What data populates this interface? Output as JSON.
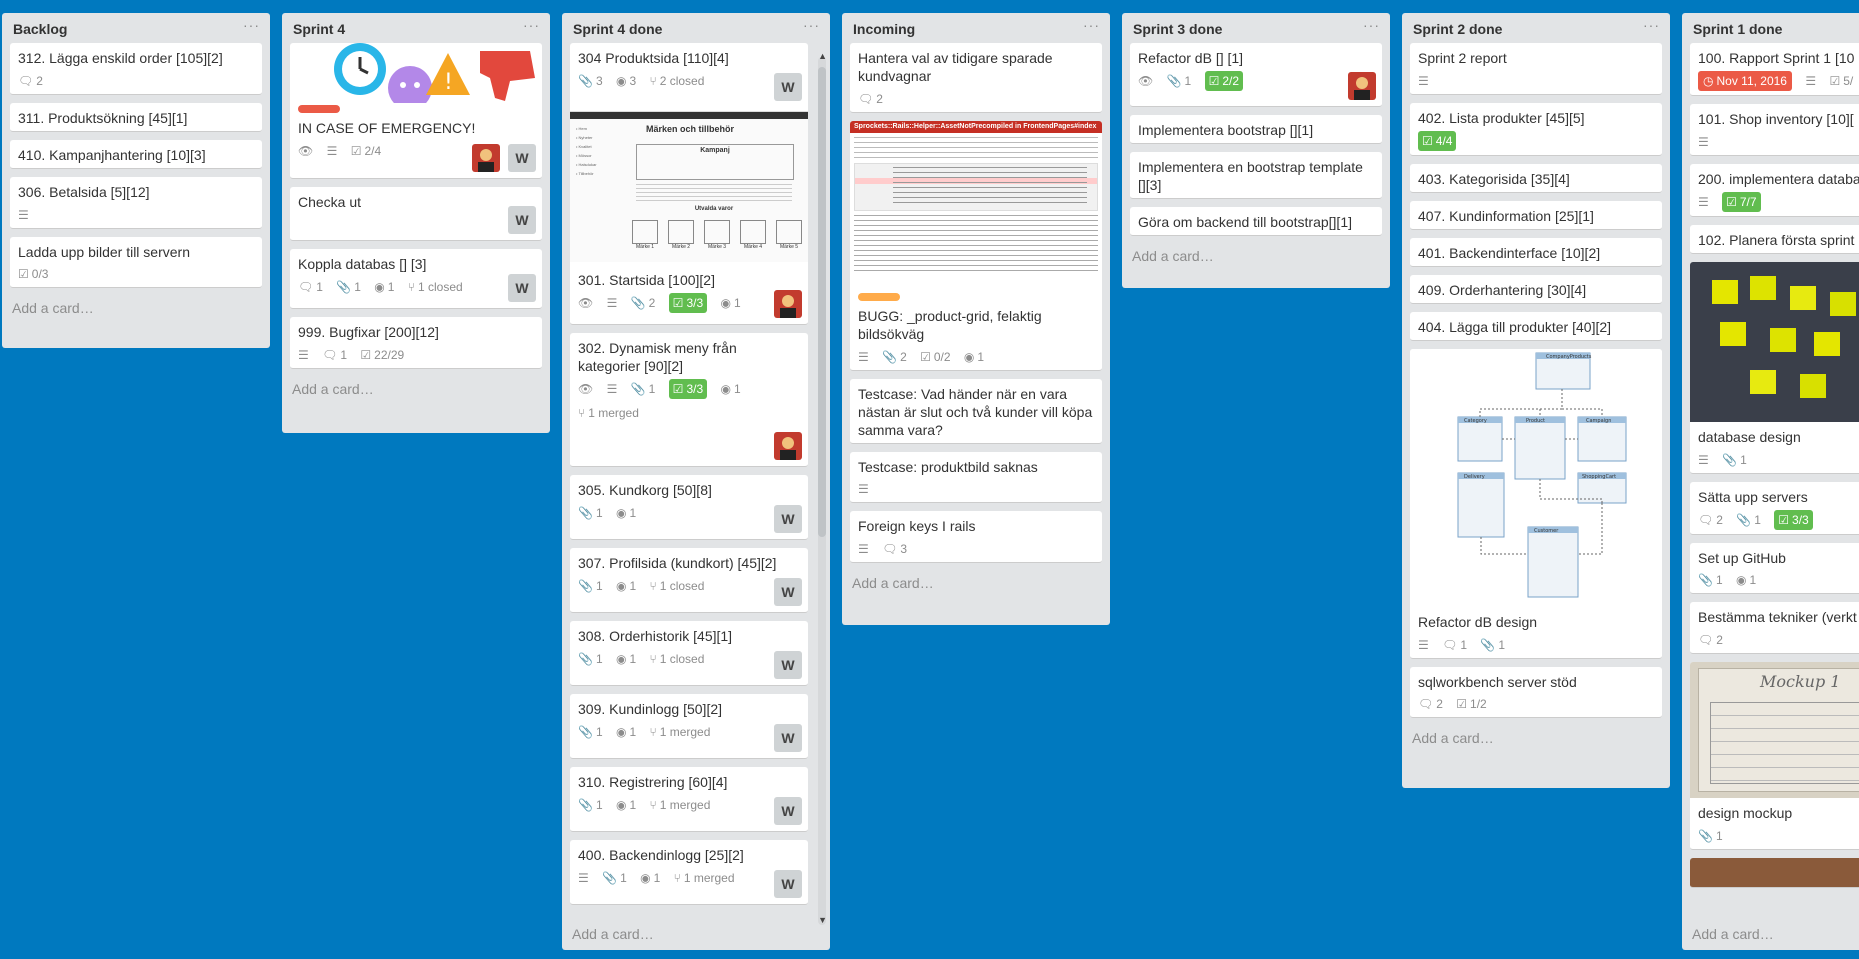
{
  "board": {
    "add_card_label": "Add a card…",
    "colors": {
      "background": "#0079bf",
      "list": "#e2e4e6",
      "green": "#61bd4f",
      "red": "#eb5a46",
      "orange": "#ffab4a"
    },
    "lists": [
      {
        "title": "Backlog",
        "cards": [
          {
            "title": "312. Lägga enskild order [105][2]",
            "comments": "2"
          },
          {
            "title": "311. Produktsökning [45][1]"
          },
          {
            "title": "410. Kampanjhantering [10][3]"
          },
          {
            "title": "306. Betalsida [5][12]",
            "description": true
          },
          {
            "title": "Ladda upp bilder till servern",
            "checklist": "0/3"
          }
        ]
      },
      {
        "title": "Sprint 4",
        "cards": [
          {
            "title": "IN CASE OF EMERGENCY!",
            "label_color": "#eb5a46",
            "checklist": "2/4",
            "member": "W"
          },
          {
            "title": "Checka ut",
            "member": "W"
          },
          {
            "title": "Koppla databas [] [3]",
            "comments": "1",
            "attachments": "1",
            "github": "1",
            "pr": "1 closed",
            "member": "W"
          },
          {
            "title": "999. Bugfixar [200][12]",
            "comments": "1",
            "checklist": "22/29"
          }
        ]
      },
      {
        "title": "Sprint 4 done",
        "cards": [
          {
            "title": "304 Produktsida [110][4]",
            "attachments": "3",
            "github": "3",
            "pr": "2 closed",
            "member": "W"
          },
          {
            "title": "301. Startsida [100][2]",
            "attachments": "2",
            "checklist": "3/3",
            "github": "1"
          },
          {
            "title": "302. Dynamisk meny från kategorier [90][2]",
            "attachments": "1",
            "checklist": "3/3",
            "github": "1",
            "pr": "1 merged"
          },
          {
            "title": "305. Kundkorg [50][8]",
            "attachments": "1",
            "github": "1",
            "member": "W"
          },
          {
            "title": "307. Profilsida (kundkort) [45][2]",
            "attachments": "1",
            "github": "1",
            "pr": "1 closed",
            "member": "W"
          },
          {
            "title": "308. Orderhistorik [45][1]",
            "attachments": "1",
            "github": "1",
            "pr": "1 closed",
            "member": "W"
          },
          {
            "title": "309. Kundinlogg [50][2]",
            "attachments": "1",
            "github": "1",
            "pr": "1 merged",
            "member": "W"
          },
          {
            "title": "310. Registrering [60][4]",
            "attachments": "1",
            "github": "1",
            "pr": "1 merged",
            "member": "W"
          },
          {
            "title": "400. Backendinlogg [25][2]",
            "attachments": "1",
            "github": "1",
            "pr": "1 merged",
            "member": "W"
          }
        ],
        "mockup": {
          "title": "Märken och tillbehör",
          "banner": "Kampanj",
          "section": "Utvalda varor",
          "items": [
            "Märke 1",
            "Märke 2",
            "Märke 3",
            "Märke 4",
            "Märke 5"
          ]
        }
      },
      {
        "title": "Incoming",
        "cards": [
          {
            "title": "Hantera val av tidigare sparade kundvagnar",
            "comments": "2"
          },
          {
            "title": "BUGG: _product-grid, felaktig bildsökväg",
            "label_color": "#ffab4a",
            "attachments": "2",
            "checklist": "0/2",
            "github": "1"
          },
          {
            "title": "Testcase: Vad händer när en vara nästan är slut och två kunder vill köpa samma vara?"
          },
          {
            "title": "Testcase: produktbild saknas"
          },
          {
            "title": "Foreign keys I rails",
            "comments": "3"
          }
        ],
        "error_image": {
          "heading": "Sprockets::Rails::Helper::AssetNotPrecompiled in FrontendPages#index"
        }
      },
      {
        "title": "Sprint 3 done",
        "cards": [
          {
            "title": "Refactor dB [] [1]",
            "attachments": "1",
            "checklist": "2/2"
          },
          {
            "title": "Implementera bootstrap [][1]"
          },
          {
            "title": "Implementera en bootstrap template [][3]"
          },
          {
            "title": "Göra om backend till bootstrap[][1]"
          }
        ]
      },
      {
        "title": "Sprint 2 done",
        "cards": [
          {
            "title": "Sprint 2 report"
          },
          {
            "title": "402. Lista produkter [45][5]",
            "checklist": "4/4"
          },
          {
            "title": "403. Kategorisida [35][4]"
          },
          {
            "title": "407. Kundinformation [25][1]"
          },
          {
            "title": "401. Backendinterface [10][2]"
          },
          {
            "title": "409. Orderhantering [30][4]"
          },
          {
            "title": "404. Lägga till produkter [40][2]"
          },
          {
            "title": "Refactor dB design",
            "comments": "1",
            "attachments": "1"
          },
          {
            "title": "sqlworkbench server stöd",
            "comments": "2",
            "checklist": "1/2"
          }
        ],
        "erd_tables": [
          "CompanyProducts",
          "Category",
          "Product",
          "Campaign",
          "Delivery",
          "ShoppingCart",
          "Customer"
        ]
      },
      {
        "title": "Sprint 1 done",
        "cards": [
          {
            "title": "100. Rapport Sprint 1 [10",
            "due": "Nov 11, 2016",
            "checklist": "5/"
          },
          {
            "title": "101. Shop inventory [10]["
          },
          {
            "title": "200. implementera databa [60][4]",
            "checklist": "7/7"
          },
          {
            "title": "102. Planera första sprint"
          },
          {
            "title": "database design",
            "attachments": "1"
          },
          {
            "title": "Sätta upp servers",
            "comments": "2",
            "attachments": "1",
            "checklist": "3/3"
          },
          {
            "title": "Set up GitHub",
            "attachments": "1",
            "github": "1"
          },
          {
            "title": "Bestämma tekniker (verkt",
            "comments": "2"
          },
          {
            "title": "design mockup",
            "attachments": "1"
          }
        ],
        "mockup_photo_text": "Mockup 1"
      }
    ]
  }
}
